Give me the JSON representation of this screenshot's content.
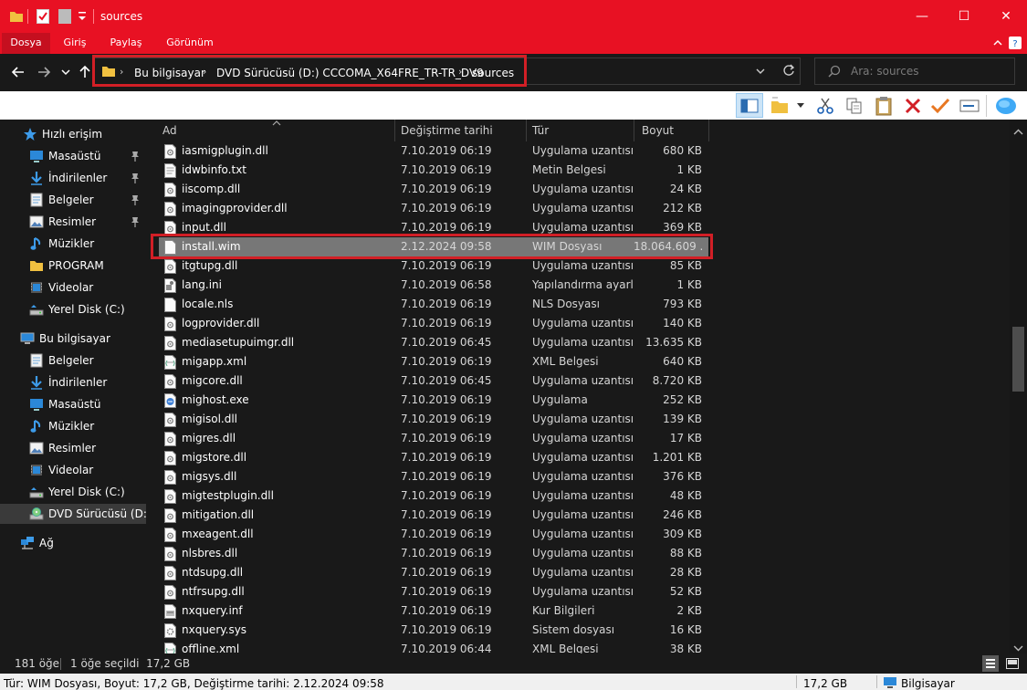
{
  "window": {
    "title": "sources",
    "minimize_glyph": "—",
    "maximize_glyph": "☐",
    "close_glyph": "✕"
  },
  "ribbon": {
    "tabs": [
      "Dosya",
      "Giriş",
      "Paylaş",
      "Görünüm"
    ],
    "active_tab": "Dosya"
  },
  "address": {
    "breadcrumbs": [
      "Bu bilgisayar",
      "DVD Sürücüsü (D:) CCCOMA_X64FRE_TR-TR_DV9",
      "sources"
    ],
    "search_placeholder": "Ara: sources"
  },
  "navigation": {
    "items": [
      {
        "label": "Hızlı erişim",
        "icon": "star-icon",
        "pinned": false
      },
      {
        "label": "Masaüstü",
        "icon": "desktop-icon",
        "pinned": true
      },
      {
        "label": "İndirilenler",
        "icon": "download-icon",
        "pinned": true
      },
      {
        "label": "Belgeler",
        "icon": "document-icon",
        "pinned": true
      },
      {
        "label": "Resimler",
        "icon": "pictures-icon",
        "pinned": true
      },
      {
        "label": "Müzikler",
        "icon": "music-icon",
        "pinned": false
      },
      {
        "label": "PROGRAM",
        "icon": "folder-icon",
        "pinned": false
      },
      {
        "label": "Videolar",
        "icon": "video-icon",
        "pinned": false
      },
      {
        "label": "Yerel Disk (C:)",
        "icon": "drive-icon",
        "pinned": false
      },
      {
        "label": "Bu bilgisayar",
        "icon": "computer-icon",
        "pinned": false
      },
      {
        "label": "Belgeler",
        "icon": "document-icon",
        "pinned": false
      },
      {
        "label": "İndirilenler",
        "icon": "download-icon",
        "pinned": false
      },
      {
        "label": "Masaüstü",
        "icon": "desktop-icon",
        "pinned": false
      },
      {
        "label": "Müzikler",
        "icon": "music-icon",
        "pinned": false
      },
      {
        "label": "Resimler",
        "icon": "pictures-icon",
        "pinned": false
      },
      {
        "label": "Videolar",
        "icon": "video-icon",
        "pinned": false
      },
      {
        "label": "Yerel Disk (C:)",
        "icon": "drive-icon",
        "pinned": false
      },
      {
        "label": "DVD Sürücüsü (D:) C",
        "icon": "dvd-icon",
        "pinned": false
      },
      {
        "label": "Ağ",
        "icon": "network-icon",
        "pinned": false
      }
    ]
  },
  "columns": {
    "name": "Ad",
    "date": "Değiştirme tarihi",
    "type": "Tür",
    "size": "Boyut"
  },
  "files": [
    {
      "name": "iasmigplugin.dll",
      "date": "7.10.2019 06:19",
      "type": "Uygulama uzantısı",
      "size": "680 KB",
      "icon": "dll-file-icon"
    },
    {
      "name": "idwbinfo.txt",
      "date": "7.10.2019 06:19",
      "type": "Metin Belgesi",
      "size": "1 KB",
      "icon": "text-file-icon"
    },
    {
      "name": "iiscomp.dll",
      "date": "7.10.2019 06:19",
      "type": "Uygulama uzantısı",
      "size": "24 KB",
      "icon": "dll-file-icon"
    },
    {
      "name": "imagingprovider.dll",
      "date": "7.10.2019 06:19",
      "type": "Uygulama uzantısı",
      "size": "212 KB",
      "icon": "dll-file-icon"
    },
    {
      "name": "input.dll",
      "date": "7.10.2019 06:19",
      "type": "Uygulama uzantısı",
      "size": "369 KB",
      "icon": "dll-file-icon"
    },
    {
      "name": "install.wim",
      "date": "2.12.2024 09:58",
      "type": "WIM Dosyası",
      "size": "18.064.609 ...",
      "icon": "file-icon",
      "selected": true
    },
    {
      "name": "itgtupg.dll",
      "date": "7.10.2019 06:19",
      "type": "Uygulama uzantısı",
      "size": "85 KB",
      "icon": "dll-file-icon"
    },
    {
      "name": "lang.ini",
      "date": "7.10.2019 06:58",
      "type": "Yapılandırma ayarl...",
      "size": "1 KB",
      "icon": "ini-file-icon"
    },
    {
      "name": "locale.nls",
      "date": "7.10.2019 06:19",
      "type": "NLS Dosyası",
      "size": "793 KB",
      "icon": "file-icon"
    },
    {
      "name": "logprovider.dll",
      "date": "7.10.2019 06:19",
      "type": "Uygulama uzantısı",
      "size": "140 KB",
      "icon": "dll-file-icon"
    },
    {
      "name": "mediasetupuimgr.dll",
      "date": "7.10.2019 06:45",
      "type": "Uygulama uzantısı",
      "size": "13.635 KB",
      "icon": "dll-file-icon"
    },
    {
      "name": "migapp.xml",
      "date": "7.10.2019 06:19",
      "type": "XML Belgesi",
      "size": "640 KB",
      "icon": "xml-file-icon"
    },
    {
      "name": "migcore.dll",
      "date": "7.10.2019 06:45",
      "type": "Uygulama uzantısı",
      "size": "8.720 KB",
      "icon": "dll-file-icon"
    },
    {
      "name": "mighost.exe",
      "date": "7.10.2019 06:19",
      "type": "Uygulama",
      "size": "252 KB",
      "icon": "exe-file-icon"
    },
    {
      "name": "migisol.dll",
      "date": "7.10.2019 06:19",
      "type": "Uygulama uzantısı",
      "size": "139 KB",
      "icon": "dll-file-icon"
    },
    {
      "name": "migres.dll",
      "date": "7.10.2019 06:19",
      "type": "Uygulama uzantısı",
      "size": "17 KB",
      "icon": "dll-file-icon"
    },
    {
      "name": "migstore.dll",
      "date": "7.10.2019 06:19",
      "type": "Uygulama uzantısı",
      "size": "1.201 KB",
      "icon": "dll-file-icon"
    },
    {
      "name": "migsys.dll",
      "date": "7.10.2019 06:19",
      "type": "Uygulama uzantısı",
      "size": "376 KB",
      "icon": "dll-file-icon"
    },
    {
      "name": "migtestplugin.dll",
      "date": "7.10.2019 06:19",
      "type": "Uygulama uzantısı",
      "size": "48 KB",
      "icon": "dll-file-icon"
    },
    {
      "name": "mitigation.dll",
      "date": "7.10.2019 06:19",
      "type": "Uygulama uzantısı",
      "size": "246 KB",
      "icon": "dll-file-icon"
    },
    {
      "name": "mxeagent.dll",
      "date": "7.10.2019 06:19",
      "type": "Uygulama uzantısı",
      "size": "309 KB",
      "icon": "dll-file-icon"
    },
    {
      "name": "nlsbres.dll",
      "date": "7.10.2019 06:19",
      "type": "Uygulama uzantısı",
      "size": "88 KB",
      "icon": "dll-file-icon"
    },
    {
      "name": "ntdsupg.dll",
      "date": "7.10.2019 06:19",
      "type": "Uygulama uzantısı",
      "size": "28 KB",
      "icon": "dll-file-icon"
    },
    {
      "name": "ntfrsupg.dll",
      "date": "7.10.2019 06:19",
      "type": "Uygulama uzantısı",
      "size": "52 KB",
      "icon": "dll-file-icon"
    },
    {
      "name": "nxquery.inf",
      "date": "7.10.2019 06:19",
      "type": "Kur Bilgileri",
      "size": "2 KB",
      "icon": "inf-file-icon"
    },
    {
      "name": "nxquery.sys",
      "date": "7.10.2019 06:19",
      "type": "Sistem dosyası",
      "size": "16 KB",
      "icon": "sys-file-icon"
    },
    {
      "name": "offline.xml",
      "date": "7.10.2019 06:44",
      "type": "XML Belgesi",
      "size": "38 KB",
      "icon": "xml-file-icon"
    }
  ],
  "status": {
    "item_count": "181 öğe",
    "selected": "1 öğe seçildi  17,2 GB",
    "details": "Tür: WIM Dosyası, Boyut: 17,2 GB, Değiştirme tarihi: 2.12.2024 09:58",
    "size_total": "17,2 GB",
    "location": "Bilgisayar"
  },
  "scroll": {
    "thumb_position": 0.38,
    "thumb_fraction": 0.13
  },
  "colors": {
    "titlebar": "#e81123",
    "background": "#191919",
    "selection": "#777777",
    "highlight_box": "#d21f26"
  }
}
